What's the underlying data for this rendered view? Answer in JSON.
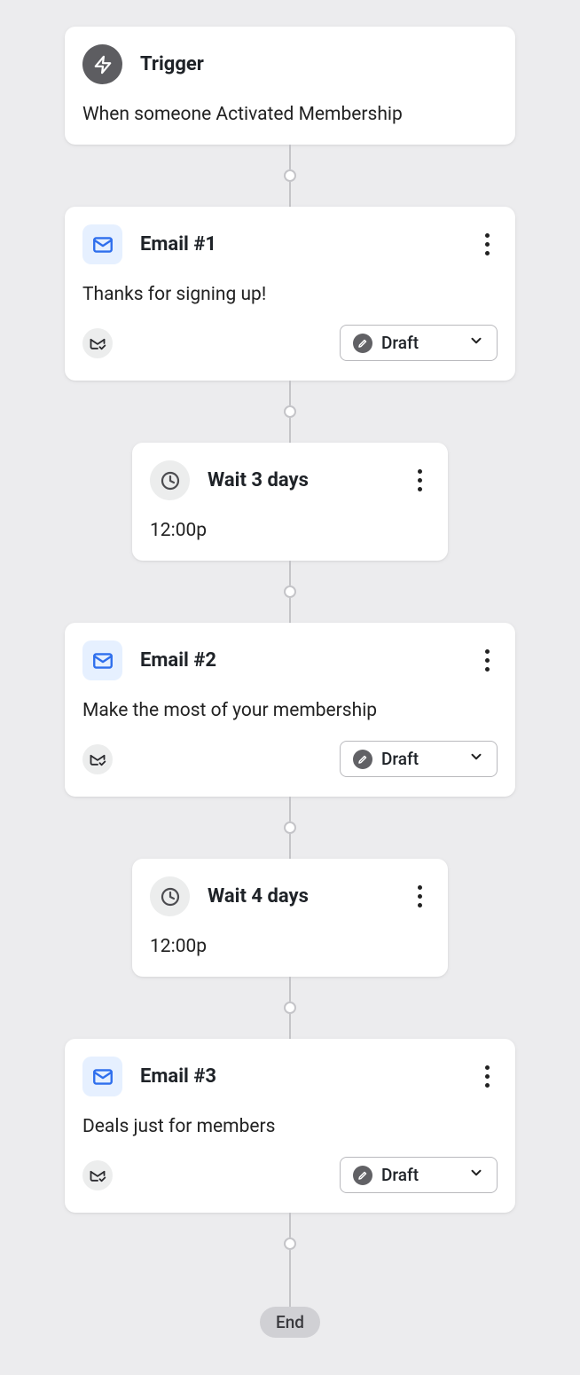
{
  "trigger": {
    "title": "Trigger",
    "description": "When someone Activated Membership"
  },
  "email1": {
    "title": "Email #1",
    "description": "Thanks for signing up!",
    "status": "Draft"
  },
  "wait1": {
    "title": "Wait 3 days",
    "time": "12:00p"
  },
  "email2": {
    "title": "Email #2",
    "description": "Make the most of your membership",
    "status": "Draft"
  },
  "wait2": {
    "title": "Wait 4 days",
    "time": "12:00p"
  },
  "email3": {
    "title": "Email #3",
    "description": "Deals just for members",
    "status": "Draft"
  },
  "end": "End"
}
